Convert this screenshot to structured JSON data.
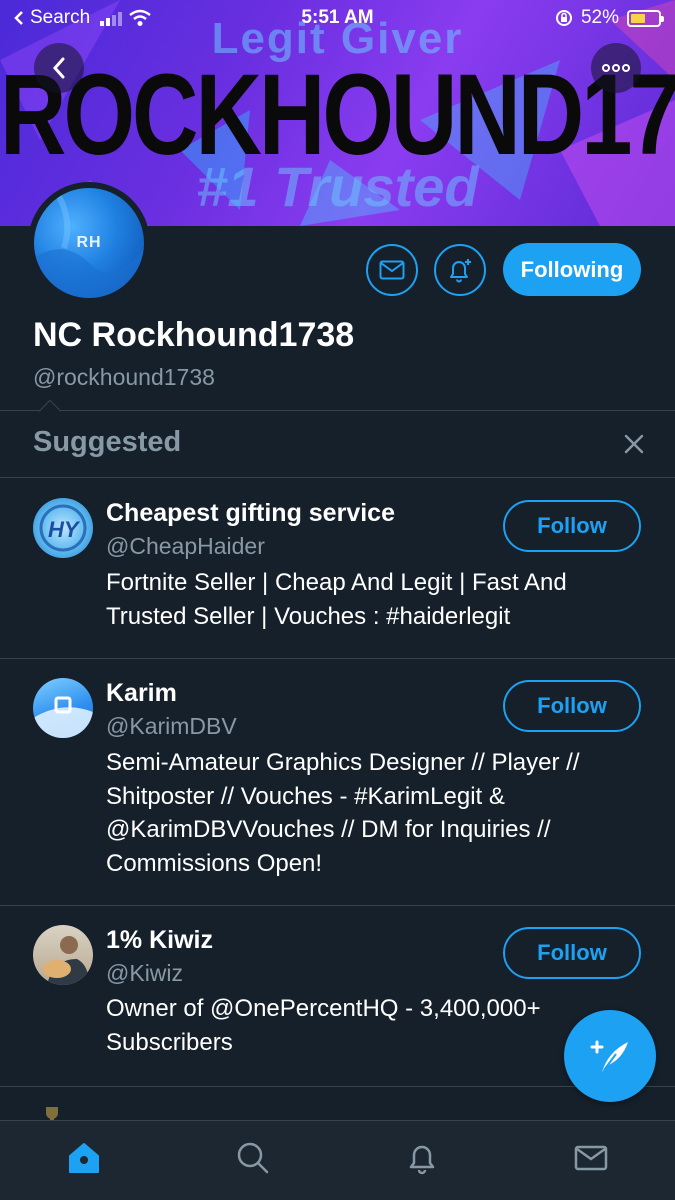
{
  "status_bar": {
    "back_app": "Search",
    "time": "5:51 AM",
    "battery": "52%",
    "battery_level": 0.52
  },
  "banner": {
    "line1": "Legit Giver",
    "line2": "ROCKHOUND1738",
    "line3": "#1 Trusted"
  },
  "profile": {
    "avatar_text": "RH",
    "display_name": "NC Rockhound1738",
    "handle": "@rockhound1738",
    "following_label": "Following"
  },
  "suggested": {
    "title": "Suggested",
    "users": [
      {
        "name": "Cheapest gifting service",
        "handle": "@CheapHaider",
        "bio": "Fortnite Seller | Cheap And Legit | Fast And Trusted Seller | Vouches : #haiderlegit",
        "follow_label": "Follow"
      },
      {
        "name": "Karim",
        "handle": "@KarimDBV",
        "bio": "Semi-Amateur Graphics Designer // Player // Shitposter // Vouches - #KarimLegit & @KarimDBVVouches // DM for Inquiries // Commissions Open!",
        "follow_label": "Follow"
      },
      {
        "name": "1% Kiwiz",
        "handle": "@Kiwiz",
        "bio": "Owner of @OnePercentHQ - 3,400,000+ Subscribers",
        "follow_label": "Follow"
      }
    ]
  },
  "colors": {
    "background": "#15202b",
    "accent": "#1da1f2",
    "secondary_text": "#8899a6",
    "divider": "#38444d"
  },
  "icons": [
    "back-chevron-icon",
    "more-icon",
    "mail-icon",
    "bell-plus-icon",
    "close-icon",
    "compose-icon",
    "home-icon",
    "search-icon",
    "notifications-icon",
    "messages-icon"
  ]
}
